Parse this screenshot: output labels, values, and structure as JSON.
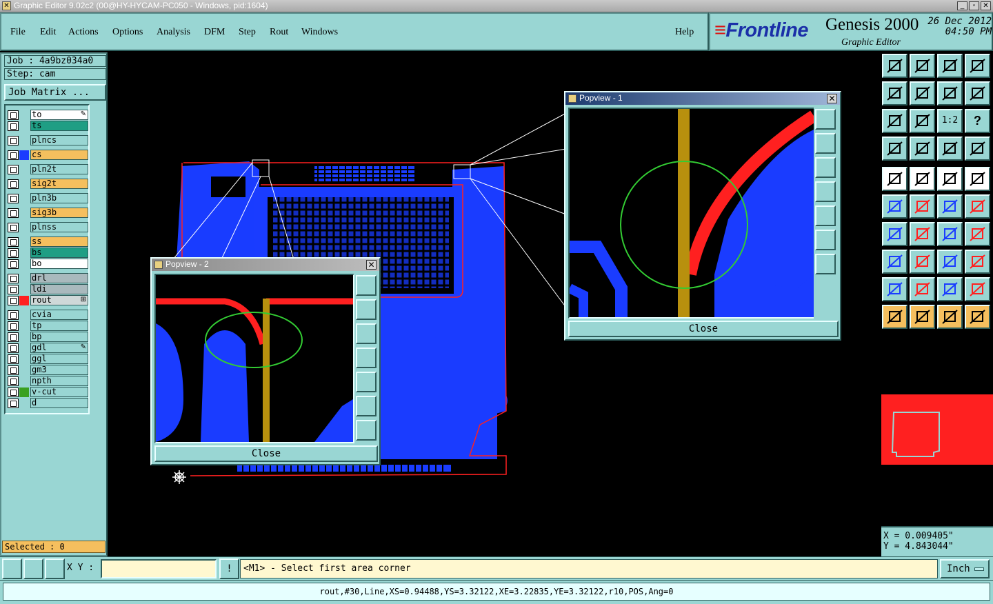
{
  "window": {
    "title": "Graphic Editor 9.02c2 (00@HY-HYCAM-PC050 - Windows, pid:1604)",
    "min_label": "_",
    "max_label": "▫",
    "close_label": "✕"
  },
  "menu": {
    "items": [
      "File",
      "Edit",
      "Actions",
      "Options",
      "Analysis",
      "DFM",
      "Step",
      "Rout",
      "Windows"
    ],
    "help": "Help"
  },
  "brand": {
    "logo": "Frontline",
    "product": "Genesis 2000",
    "subtitle": "Graphic Editor",
    "date": "26 Dec 2012",
    "time": "04:50 PM"
  },
  "left": {
    "job": "Job : 4a9bz034a0",
    "step": "Step: cam",
    "job_matrix": "Job Matrix ...",
    "selected": "Selected : 0",
    "layers": [
      {
        "name": "to",
        "bg": "#ffffff",
        "swatch": "",
        "mark": "✎"
      },
      {
        "name": "ts",
        "bg": "#1f9e84",
        "swatch": "",
        "mark": ""
      },
      {
        "name": "plncs",
        "bg": "#99d6d3",
        "swatch": "",
        "mark": ""
      },
      {
        "name": "cs",
        "bg": "#f5bf5e",
        "swatch": "#1a3cff",
        "mark": ""
      },
      {
        "name": "pln2t",
        "bg": "#99d6d3",
        "swatch": "",
        "mark": ""
      },
      {
        "name": "sig2t",
        "bg": "#f5bf5e",
        "swatch": "",
        "mark": ""
      },
      {
        "name": "pln3b",
        "bg": "#99d6d3",
        "swatch": "",
        "mark": ""
      },
      {
        "name": "sig3b",
        "bg": "#f5bf5e",
        "swatch": "",
        "mark": ""
      },
      {
        "name": "plnss",
        "bg": "#99d6d3",
        "swatch": "",
        "mark": ""
      },
      {
        "name": "ss",
        "bg": "#f5bf5e",
        "swatch": "",
        "mark": ""
      },
      {
        "name": "bs",
        "bg": "#1f9e84",
        "swatch": "",
        "mark": ""
      },
      {
        "name": "bo",
        "bg": "#ffffff",
        "swatch": "",
        "mark": ""
      },
      {
        "name": "drl",
        "bg": "#a9b9bd",
        "swatch": "",
        "mark": ""
      },
      {
        "name": "ldi",
        "bg": "#a9b9bd",
        "swatch": "",
        "mark": ""
      },
      {
        "name": "rout",
        "bg": "#cfd8d8",
        "swatch": "#ff2020",
        "mark": "⊞"
      },
      {
        "name": "cvia",
        "bg": "#99d6d3",
        "swatch": "",
        "mark": ""
      },
      {
        "name": "tp",
        "bg": "#99d6d3",
        "swatch": "",
        "mark": ""
      },
      {
        "name": "bp",
        "bg": "#99d6d3",
        "swatch": "",
        "mark": ""
      },
      {
        "name": "gdl",
        "bg": "#99d6d3",
        "swatch": "",
        "mark": "✎"
      },
      {
        "name": "ggl",
        "bg": "#99d6d3",
        "swatch": "",
        "mark": ""
      },
      {
        "name": "gm3",
        "bg": "#99d6d3",
        "swatch": "",
        "mark": ""
      },
      {
        "name": "npth",
        "bg": "#99d6d3",
        "swatch": "",
        "mark": ""
      },
      {
        "name": "v-cut",
        "bg": "#99d6d3",
        "swatch": "#3aa020",
        "mark": ""
      },
      {
        "name": "d",
        "bg": "#99d6d3",
        "swatch": "",
        "mark": ""
      }
    ]
  },
  "popups": {
    "p1": {
      "title": "Popview - 1",
      "close": "Close"
    },
    "p2": {
      "title": "Popview - 2",
      "close": "Close"
    }
  },
  "cmd": {
    "xy_label": "X Y :",
    "xy_value": "",
    "warn": "!",
    "prompt": "<M1> - Select first area corner",
    "unit": "Inch"
  },
  "coords": {
    "x": "X = 0.009405\"",
    "y": "Y = 4.843044\""
  },
  "status": "rout,#30,Line,XS=0.94488,YS=3.32122,XE=3.22835,YE=3.32122,r10,POS,Ang=0",
  "toolbar": {
    "scale_label": "1:2",
    "help_glyph": "?"
  },
  "colors": {
    "panel": "#99d6d3",
    "copper": "#1a3cff",
    "rout": "#ff2020",
    "highlight": "#f5bf5e"
  }
}
